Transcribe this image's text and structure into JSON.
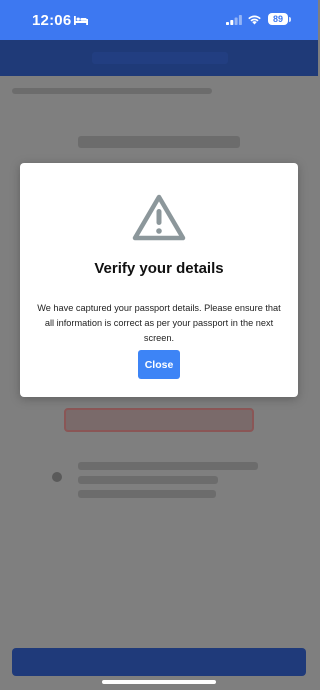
{
  "status_bar": {
    "time": "12:06",
    "battery": "89"
  },
  "modal": {
    "icon": "warning-triangle-icon",
    "title": "Verify your details",
    "message": "We have captured your passport details. Please ensure that all information is correct as per your passport in the next screen.",
    "close_label": "Close"
  },
  "colors": {
    "status_bar": "#3d78f1",
    "primary_button": "#3d84f6",
    "warning_icon": "#8c979b",
    "overlay": "#7f7f7f"
  }
}
